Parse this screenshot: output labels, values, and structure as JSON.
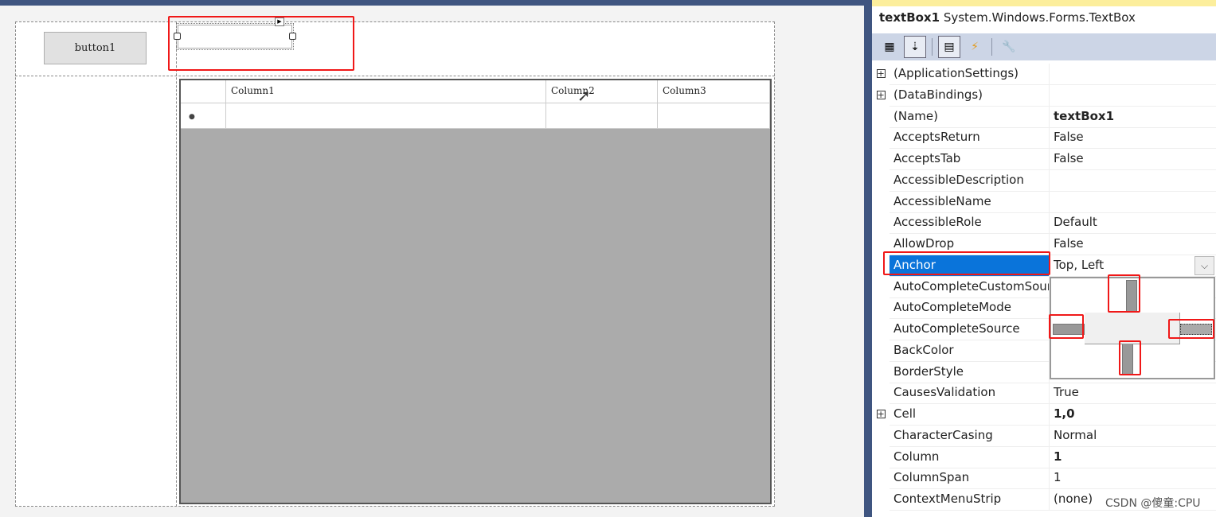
{
  "designer": {
    "button_label": "button1",
    "grid": {
      "columns": [
        "Column1",
        "Column2",
        "Column3"
      ],
      "new_row_marker": "●"
    }
  },
  "properties": {
    "object_name": "textBox1",
    "object_type": "System.Windows.Forms.TextBox",
    "toolbar": [
      {
        "name": "categorized-icon",
        "glyph": "▦",
        "active": false
      },
      {
        "name": "alphabetical-icon",
        "glyph": "⇣",
        "active": true
      },
      {
        "name": "properties-icon",
        "glyph": "▤",
        "active": true
      },
      {
        "name": "events-icon",
        "glyph": "⚡",
        "active": false
      },
      {
        "name": "property-pages-icon",
        "glyph": "🔧",
        "active": false
      }
    ],
    "rows": [
      {
        "name": "(ApplicationSettings)",
        "value": "",
        "expandable": true
      },
      {
        "name": "(DataBindings)",
        "value": "",
        "expandable": true
      },
      {
        "name": "(Name)",
        "value": "textBox1",
        "bold": true
      },
      {
        "name": "AcceptsReturn",
        "value": "False"
      },
      {
        "name": "AcceptsTab",
        "value": "False"
      },
      {
        "name": "AccessibleDescription",
        "value": ""
      },
      {
        "name": "AccessibleName",
        "value": ""
      },
      {
        "name": "AccessibleRole",
        "value": "Default"
      },
      {
        "name": "AllowDrop",
        "value": "False"
      },
      {
        "name": "Anchor",
        "value": "Top, Left",
        "selected": true
      },
      {
        "name": "AutoCompleteCustomSource",
        "value": ""
      },
      {
        "name": "AutoCompleteMode",
        "value": ""
      },
      {
        "name": "AutoCompleteSource",
        "value": ""
      },
      {
        "name": "BackColor",
        "value": ""
      },
      {
        "name": "BorderStyle",
        "value": ""
      },
      {
        "name": "CausesValidation",
        "value": "True"
      },
      {
        "name": "Cell",
        "value": "1,0",
        "bold": true,
        "expandable": true
      },
      {
        "name": "CharacterCasing",
        "value": "Normal"
      },
      {
        "name": "Column",
        "value": "1",
        "bold": true
      },
      {
        "name": "ColumnSpan",
        "value": "1"
      },
      {
        "name": "ContextMenuStrip",
        "value": "(none)"
      }
    ],
    "anchor_editor": {
      "top": true,
      "left": true,
      "right": false,
      "bottom": false
    }
  },
  "watermark": "CSDN @傻童:CPU",
  "colors": {
    "selection": "#0a74da",
    "highlight_box": "#f01818",
    "toolbar": "#ccd5e6"
  }
}
